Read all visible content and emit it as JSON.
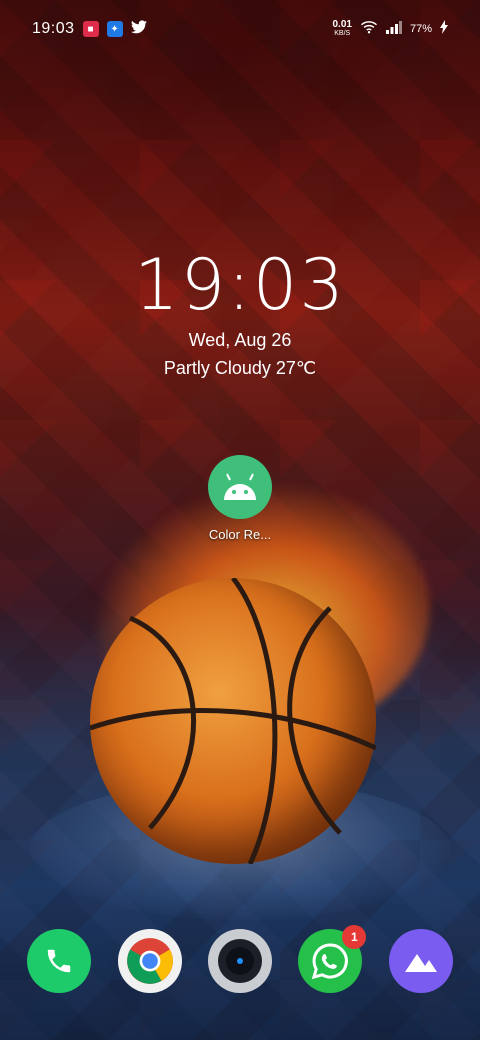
{
  "status_bar": {
    "time": "19:03",
    "notifications": [
      "app-red-icon",
      "app-blue-icon",
      "twitter-icon"
    ],
    "net_speed": "0.01",
    "net_speed_unit": "KB/S",
    "battery": "77%"
  },
  "clock_widget": {
    "time": "19:03",
    "date": "Wed, Aug 26",
    "weather": "Partly Cloudy 27℃"
  },
  "home_apps": [
    {
      "label": "Color Re...",
      "icon": "android-icon",
      "color": "#3fbf7a"
    }
  ],
  "dock": [
    {
      "name": "phone",
      "icon": "phone-icon",
      "color": "#1ecb6b"
    },
    {
      "name": "chrome",
      "icon": "chrome-icon",
      "color": "#f1f1f1"
    },
    {
      "name": "camera",
      "icon": "camera-icon",
      "color": "#c9ccd1"
    },
    {
      "name": "whatsapp",
      "icon": "whatsapp-icon",
      "color": "#25c04a",
      "badge": "1"
    },
    {
      "name": "gallery",
      "icon": "gallery-icon",
      "color": "#7a5cf0"
    }
  ]
}
